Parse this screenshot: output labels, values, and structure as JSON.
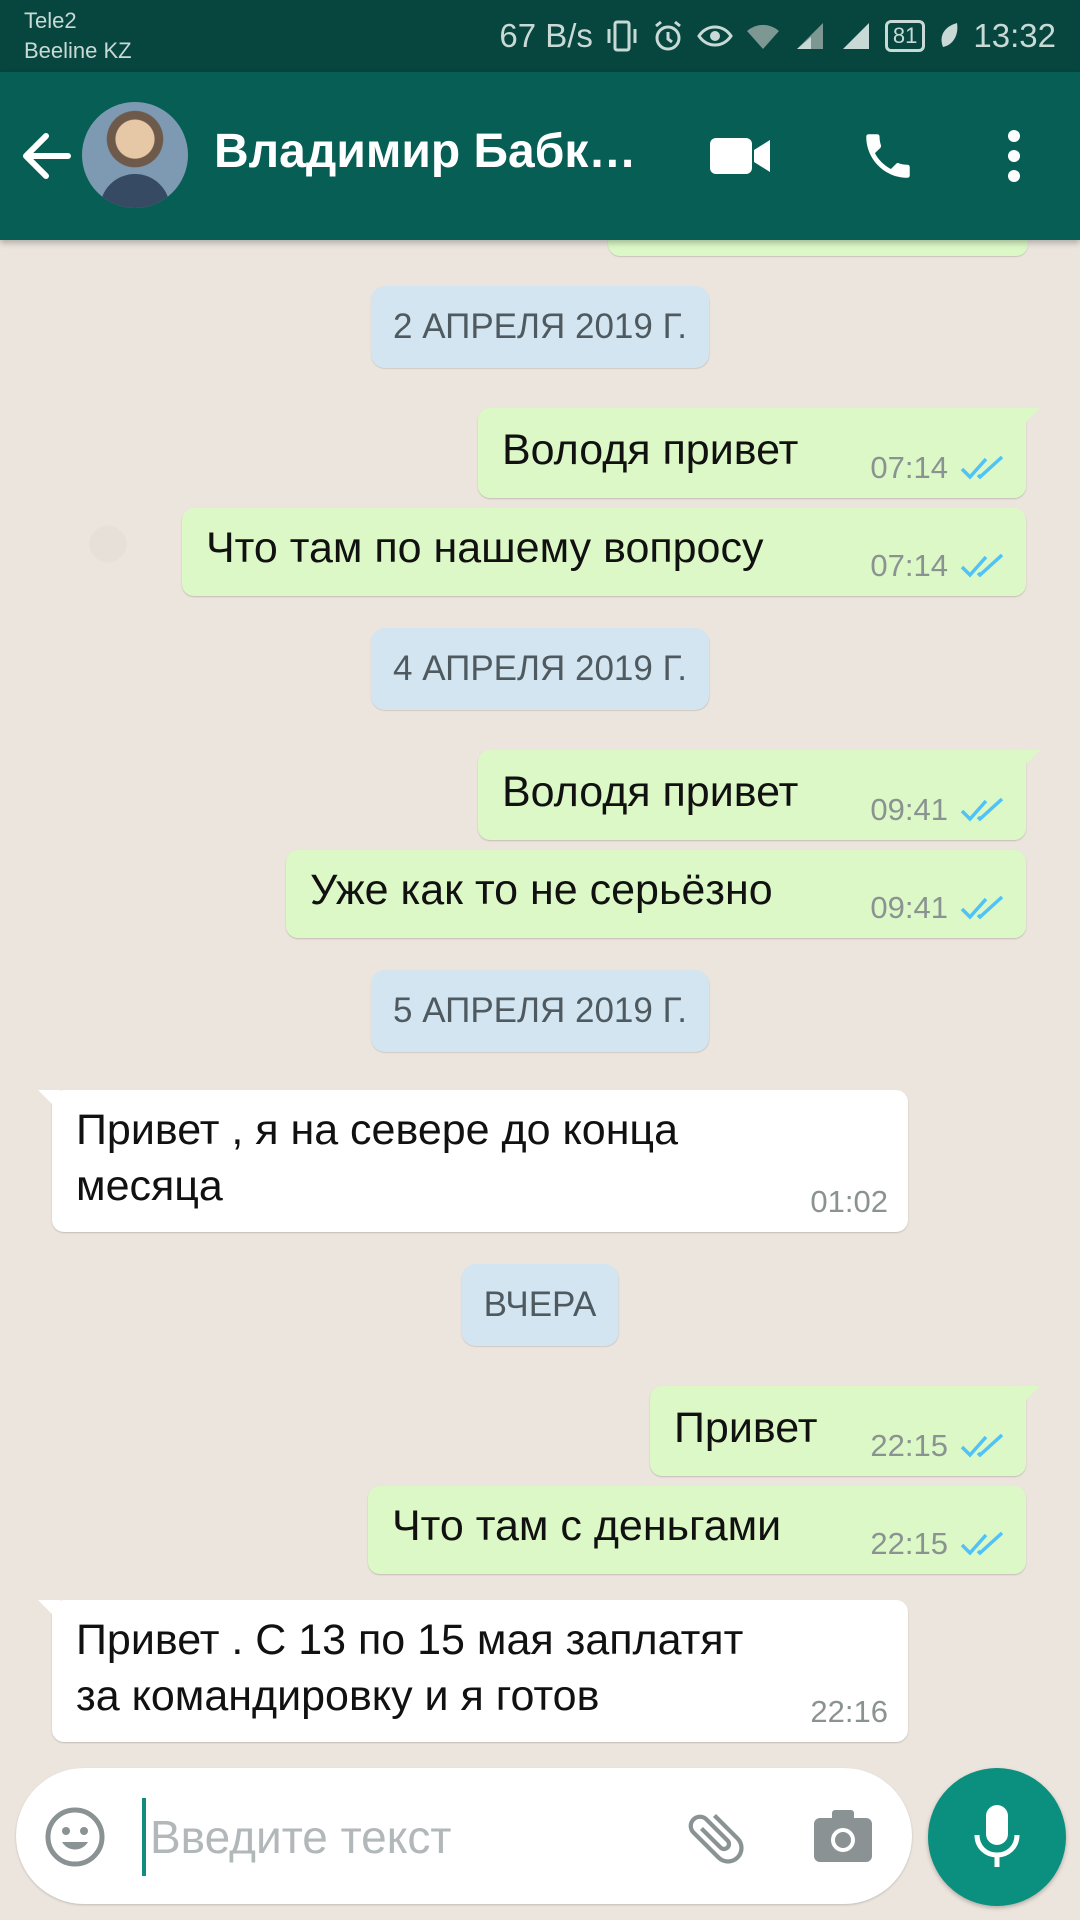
{
  "status_bar": {
    "carrier_1": "Tele2",
    "carrier_2": "Beeline KZ",
    "net_speed": "67 B/s",
    "battery": "81",
    "time": "13:32"
  },
  "header": {
    "contact_name": "Владимир Бабк…"
  },
  "messages": [
    {
      "date": "2 АПРЕЛЯ 2019 Г."
    },
    {
      "dir": "out",
      "text": "Володя привет",
      "time": "07:14"
    },
    {
      "dir": "out",
      "text": "Что там по нашему вопросу",
      "time": "07:14"
    },
    {
      "date": "4 АПРЕЛЯ 2019 Г."
    },
    {
      "dir": "out",
      "text": "Володя привет",
      "time": "09:41"
    },
    {
      "dir": "out",
      "text": "Уже как то не серьёзно",
      "time": "09:41"
    },
    {
      "date": "5 АПРЕЛЯ 2019 Г."
    },
    {
      "dir": "in",
      "line1": "Привет , я на севере до конца",
      "line2": "месяца",
      "time": "01:02"
    },
    {
      "date": "ВЧЕРА"
    },
    {
      "dir": "out",
      "text": "Привет",
      "time": "22:15"
    },
    {
      "dir": "out",
      "text": "Что там с деньгами",
      "time": "22:15"
    },
    {
      "dir": "in",
      "line1": "Привет . С 13 по 15 мая заплатят",
      "line2": "за командировку и я готов",
      "time": "22:16"
    }
  ],
  "composer": {
    "placeholder": "Введите текст"
  },
  "colors": {
    "header": "#075e54",
    "outgoing_bubble": "#dcf8c6",
    "incoming_bubble": "#ffffff",
    "read_ticks": "#4fc3f7",
    "mic_button": "#0b8f7e"
  }
}
